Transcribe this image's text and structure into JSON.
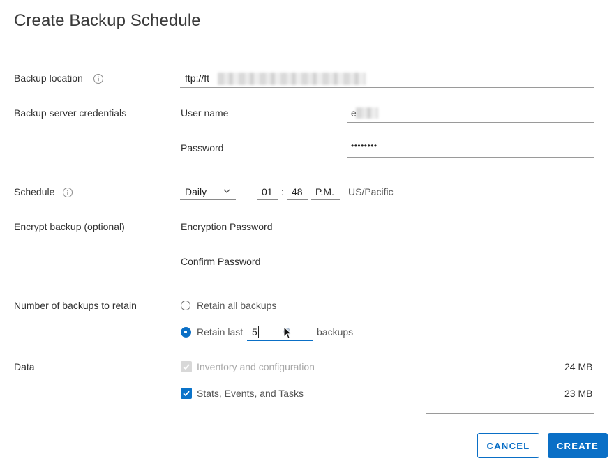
{
  "dialog": {
    "title": "Create Backup Schedule"
  },
  "backup_location": {
    "label": "Backup location",
    "value": "ftp://ft",
    "info_icon": "info-icon"
  },
  "credentials": {
    "label": "Backup server credentials",
    "username_label": "User name",
    "username_value": "e",
    "password_label": "Password",
    "password_value": "••••••••"
  },
  "schedule": {
    "label": "Schedule",
    "frequency": "Daily",
    "hour": "01",
    "separator": ":",
    "minute": "48",
    "ampm": "P.M.",
    "timezone": "US/Pacific"
  },
  "encrypt": {
    "label": "Encrypt backup (optional)",
    "password_label": "Encryption Password",
    "confirm_label": "Confirm Password"
  },
  "retain": {
    "label": "Number of backups to retain",
    "option_all": "Retain all backups",
    "option_last": "Retain last",
    "last_value": "5",
    "suffix": "backups",
    "selected": "last"
  },
  "data_section": {
    "label": "Data",
    "items": [
      {
        "label": "Inventory and configuration",
        "size": "24 MB",
        "checked": true,
        "disabled": true
      },
      {
        "label": "Stats, Events, and Tasks",
        "size": "23 MB",
        "checked": true,
        "disabled": false
      }
    ]
  },
  "buttons": {
    "cancel": "CANCEL",
    "create": "CREATE"
  },
  "colors": {
    "accent": "#0a6fc6",
    "text": "#313131",
    "disabled": "#a8a8a8"
  }
}
